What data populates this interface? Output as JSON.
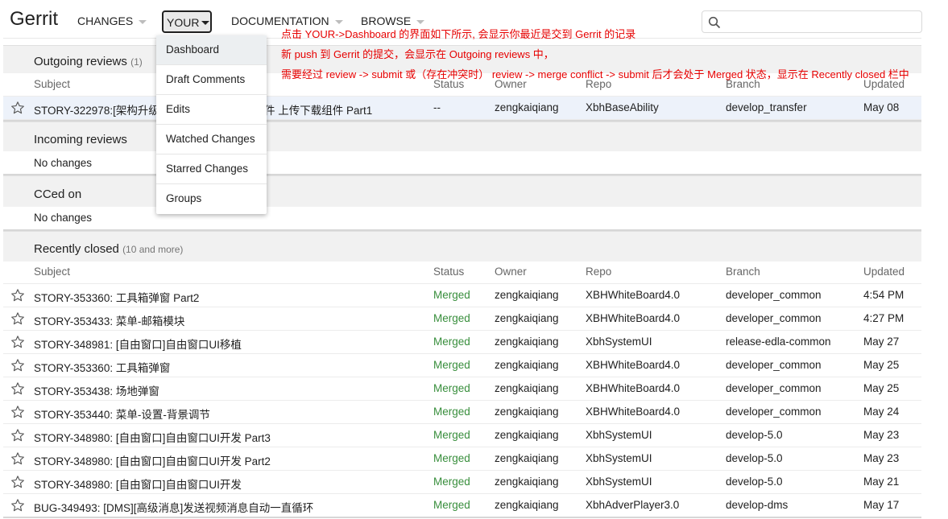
{
  "header": {
    "logo": "Gerrit",
    "nav": [
      {
        "label": "CHANGES"
      },
      {
        "label": "YOUR"
      },
      {
        "label": "DOCUMENTATION"
      },
      {
        "label": "BROWSE"
      }
    ],
    "search": {
      "placeholder": "",
      "value": ""
    }
  },
  "dropdown": {
    "items": [
      "Dashboard",
      "Draft Comments",
      "Edits",
      "Watched Changes",
      "Starred Changes",
      "Groups"
    ]
  },
  "annotations": [
    "点击 YOUR->Dashboard 的界面如下所示, 会显示你最近是交到 Gerrit 的记录",
    "新 push 到 Gerrit 的提交，会显示在 Outgoing reviews 中，",
    "需要经过 review -> submit 或（存在冲突时） review -> merge conflict -> submit 后才会处于 Merged 状态，显示在 Recently closed 栏中"
  ],
  "columns": {
    "subject": "Subject",
    "status": "Status",
    "owner": "Owner",
    "repo": "Repo",
    "branch": "Branch",
    "updated": "Updated"
  },
  "outgoing": {
    "title": "Outgoing reviews",
    "count": "(1)",
    "row": {
      "subject_start": "STORY-322978:[架构升级",
      "subject_end": "共组件 上传下载组件 Part1",
      "status": "--",
      "owner": "zengkaiqiang",
      "repo": "XbhBaseAbility",
      "branch": "develop_transfer",
      "updated": "May 08"
    }
  },
  "incoming": {
    "title": "Incoming reviews",
    "empty": "No changes"
  },
  "cced": {
    "title": "CCed on",
    "empty": "No changes"
  },
  "recent": {
    "title": "Recently closed",
    "count": "(10 and more)",
    "rows": [
      {
        "subject": "STORY-353360: 工具箱弹窗 Part2",
        "status": "Merged",
        "owner": "zengkaiqiang",
        "repo": "XBHWhiteBoard4.0",
        "branch": "developer_common",
        "updated": "4:54 PM"
      },
      {
        "subject": "STORY-353433: 菜单-邮箱模块",
        "status": "Merged",
        "owner": "zengkaiqiang",
        "repo": "XBHWhiteBoard4.0",
        "branch": "developer_common",
        "updated": "4:27 PM"
      },
      {
        "subject": "STORY-348981: [自由窗口]自由窗口UI移植",
        "status": "Merged",
        "owner": "zengkaiqiang",
        "repo": "XbhSystemUI",
        "branch": "release-edla-common",
        "updated": "May 27"
      },
      {
        "subject": "STORY-353360: 工具箱弹窗",
        "status": "Merged",
        "owner": "zengkaiqiang",
        "repo": "XBHWhiteBoard4.0",
        "branch": "developer_common",
        "updated": "May 25"
      },
      {
        "subject": "STORY-353438: 场地弹窗",
        "status": "Merged",
        "owner": "zengkaiqiang",
        "repo": "XBHWhiteBoard4.0",
        "branch": "developer_common",
        "updated": "May 25"
      },
      {
        "subject": "STORY-353440: 菜单-设置-背景调节",
        "status": "Merged",
        "owner": "zengkaiqiang",
        "repo": "XBHWhiteBoard4.0",
        "branch": "developer_common",
        "updated": "May 24"
      },
      {
        "subject": "STORY-348980: [自由窗口]自由窗口UI开发 Part3",
        "status": "Merged",
        "owner": "zengkaiqiang",
        "repo": "XbhSystemUI",
        "branch": "develop-5.0",
        "updated": "May 23"
      },
      {
        "subject": "STORY-348980: [自由窗口]自由窗口UI开发 Part2",
        "status": "Merged",
        "owner": "zengkaiqiang",
        "repo": "XbhSystemUI",
        "branch": "develop-5.0",
        "updated": "May 23"
      },
      {
        "subject": "STORY-348980: [自由窗口]自由窗口UI开发",
        "status": "Merged",
        "owner": "zengkaiqiang",
        "repo": "XbhSystemUI",
        "branch": "develop-5.0",
        "updated": "May 21"
      },
      {
        "subject": "BUG-349493: [DMS][高级消息]发送视频消息自动一直循环",
        "status": "Merged",
        "owner": "zengkaiqiang",
        "repo": "XbhAdverPlayer3.0",
        "branch": "develop-dms",
        "updated": "May 17"
      }
    ]
  }
}
